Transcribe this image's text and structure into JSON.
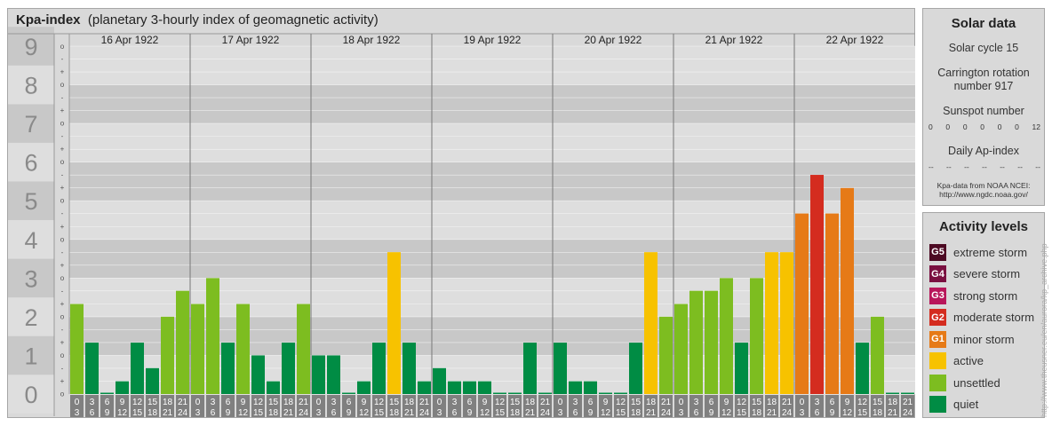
{
  "header": {
    "title": "Kpa-index",
    "subtitle": "(planetary 3-hourly index of geomagnetic activity)"
  },
  "solar": {
    "title": "Solar data",
    "cycle": "Solar cycle 15",
    "carrington": "Carrington rotation number 917",
    "sunspot_label": "Sunspot number",
    "sunspot_values": [
      "0",
      "0",
      "0",
      "0",
      "0",
      "0",
      "12"
    ],
    "ap_label": "Daily Ap-index",
    "ap_values": [
      "--",
      "--",
      "--",
      "--",
      "--",
      "--",
      "--"
    ],
    "source_line1": "Kpa-data from NOAA NCEI:",
    "source_line2": "http://www.ngdc.noaa.gov/"
  },
  "legend": {
    "title": "Activity levels",
    "items": [
      {
        "code": "G5",
        "label": "extreme storm",
        "color": "#4d0a23"
      },
      {
        "code": "G4",
        "label": "severe storm",
        "color": "#7a1040"
      },
      {
        "code": "G3",
        "label": "strong storm",
        "color": "#b8165a"
      },
      {
        "code": "G2",
        "label": "moderate storm",
        "color": "#d42c1f"
      },
      {
        "code": "G1",
        "label": "minor storm",
        "color": "#e67a17"
      },
      {
        "code": "",
        "label": "active",
        "color": "#f7c200"
      },
      {
        "code": "",
        "label": "unsettled",
        "color": "#7dbd20"
      },
      {
        "code": "",
        "label": "quiet",
        "color": "#008c44"
      }
    ]
  },
  "watermark": "http://www.theusner.eu/en/aurora/kp_archive.php",
  "chart_data": {
    "type": "bar",
    "title": "Kpa-index",
    "ylim": [
      0,
      9
    ],
    "y_ticks": [
      "0",
      "1",
      "2",
      "3",
      "4",
      "5",
      "6",
      "7",
      "8",
      "9"
    ],
    "sub_ticks": [
      "o",
      "+",
      "-"
    ],
    "days": [
      "16 Apr 1922",
      "17 Apr 1922",
      "18 Apr 1922",
      "19 Apr 1922",
      "20 Apr 1922",
      "21 Apr 1922",
      "22 Apr 1922"
    ],
    "interval_starts": [
      "0",
      "3",
      "6",
      "9",
      "12",
      "15",
      "18",
      "21"
    ],
    "interval_ends": [
      "3",
      "6",
      "9",
      "12",
      "15",
      "18",
      "21",
      "24"
    ],
    "values": [
      2.33,
      1.33,
      0,
      0.33,
      1.33,
      0.67,
      2,
      2.67,
      2.33,
      3,
      1.33,
      2.33,
      1,
      0.33,
      1.33,
      2.33,
      1,
      1,
      0,
      0.33,
      1.33,
      3.67,
      1.33,
      0.33,
      0.67,
      0.33,
      0.33,
      0.33,
      0,
      0,
      1.33,
      0,
      1.33,
      0.33,
      0.33,
      0,
      0,
      1.33,
      3.67,
      2,
      2.33,
      2.67,
      2.67,
      3,
      1.33,
      3,
      3.67,
      3.67,
      4.67,
      5.67,
      4.67,
      5.33,
      1.33,
      2,
      0,
      0
    ]
  }
}
